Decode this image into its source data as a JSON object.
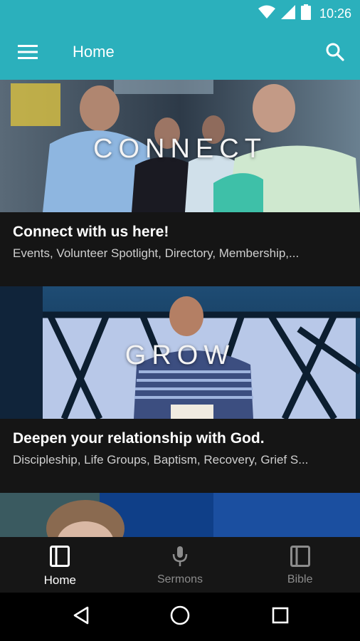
{
  "status_bar": {
    "time": "10:26",
    "icons": [
      "wifi-icon",
      "signal-icon",
      "battery-icon"
    ]
  },
  "app_bar": {
    "title": "Home",
    "icons": [
      "menu-icon",
      "search-icon"
    ]
  },
  "cards": [
    {
      "overlay_text": "CONNECT",
      "title": "Connect with us here!",
      "subtitle": "Events, Volunteer Spotlight, Directory, Membership,..."
    },
    {
      "overlay_text": "GROW",
      "title": "Deepen your relationship with God.",
      "subtitle": "Discipleship, Life Groups, Baptism, Recovery, Grief S..."
    },
    {
      "overlay_text": "",
      "title": "",
      "subtitle": ""
    }
  ],
  "bottom_nav": {
    "items": [
      {
        "label": "Home",
        "icon": "book-icon",
        "active": true
      },
      {
        "label": "Sermons",
        "icon": "microphone-icon",
        "active": false
      },
      {
        "label": "Bible",
        "icon": "bible-icon",
        "active": false
      }
    ]
  },
  "system_nav": [
    "back-icon",
    "home-circle-icon",
    "recents-icon"
  ],
  "colors": {
    "primary": "#2bb0bc",
    "card_background": "#151515",
    "nav_background": "#161616",
    "active_label": "#ffffff",
    "inactive_label": "#8c8c8c"
  }
}
